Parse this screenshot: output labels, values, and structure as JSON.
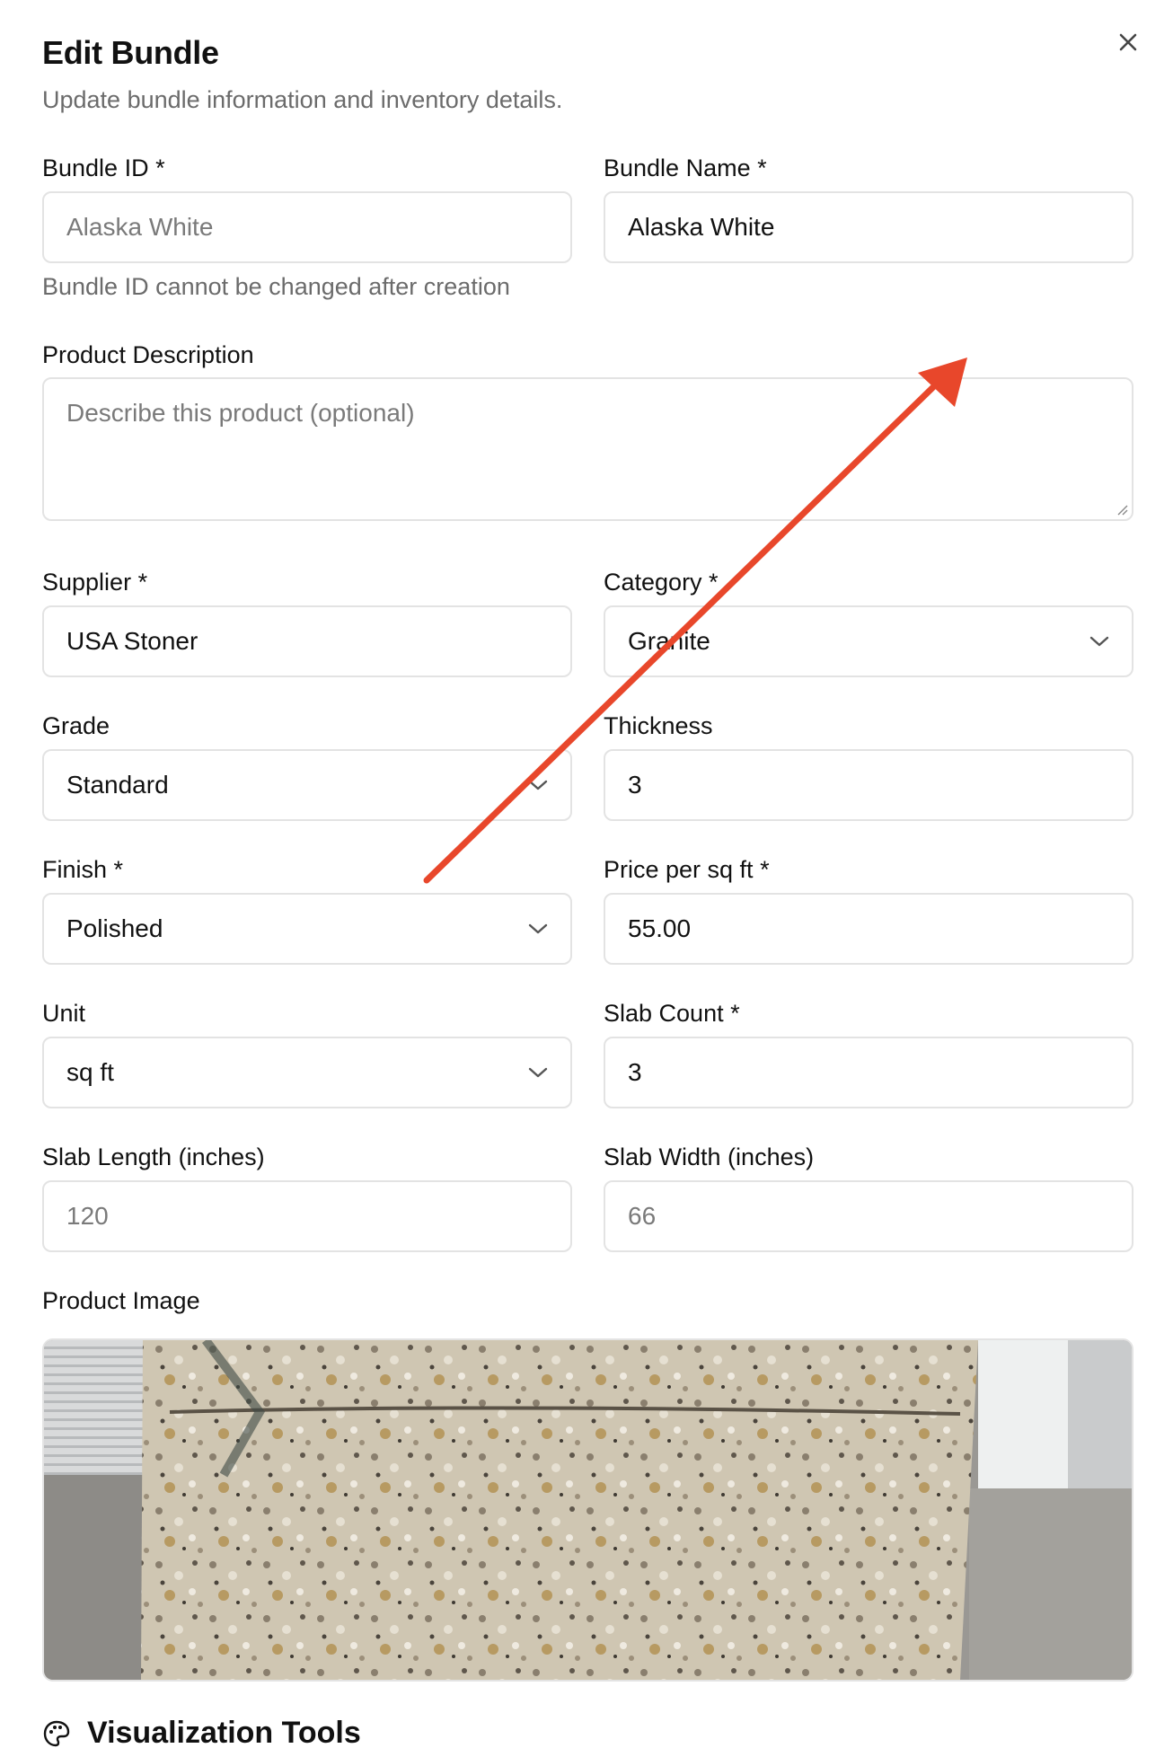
{
  "dialog": {
    "title": "Edit Bundle",
    "subtitle": "Update bundle information and inventory details.",
    "close_icon": "close-icon"
  },
  "fields": {
    "bundle_id": {
      "label": "Bundle ID *",
      "value": "Alaska White",
      "help": "Bundle ID cannot be changed after creation"
    },
    "bundle_name": {
      "label": "Bundle Name *",
      "value": "Alaska White"
    },
    "description": {
      "label": "Product Description",
      "placeholder": "Describe this product (optional)"
    },
    "supplier": {
      "label": "Supplier *",
      "value": "USA Stoner"
    },
    "category": {
      "label": "Category *",
      "value": "Granite"
    },
    "grade": {
      "label": "Grade",
      "value": "Standard"
    },
    "thickness": {
      "label": "Thickness",
      "value": "3"
    },
    "finish": {
      "label": "Finish *",
      "value": "Polished"
    },
    "price": {
      "label": "Price per sq ft *",
      "value": "55.00"
    },
    "unit": {
      "label": "Unit",
      "value": "sq ft"
    },
    "slab_count": {
      "label": "Slab Count *",
      "value": "3"
    },
    "slab_length": {
      "label": "Slab Length (inches)",
      "placeholder": "120"
    },
    "slab_width": {
      "label": "Slab Width (inches)",
      "placeholder": "66"
    }
  },
  "image": {
    "label": "Product Image"
  },
  "visualization": {
    "label": "Visualization Tools",
    "icon": "palette-icon"
  },
  "annotation": {
    "color": "#e8472b",
    "icon": "arrow-annotation"
  },
  "colors": {
    "border": "#e3e3e3",
    "muted_text": "#6b6b6b"
  }
}
